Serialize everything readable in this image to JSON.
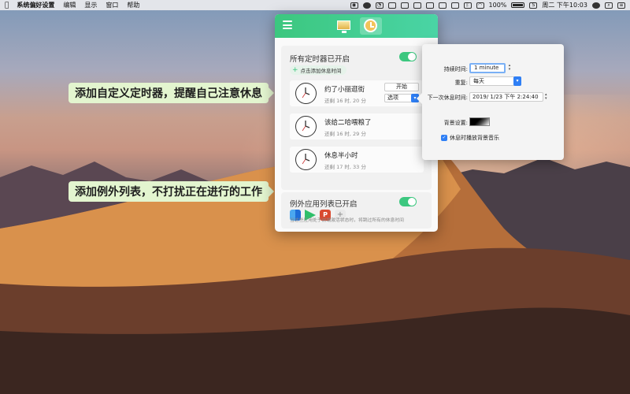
{
  "menubar": {
    "app_name": "系统偏好设置",
    "menus": [
      "编辑",
      "显示",
      "窗口",
      "帮助"
    ],
    "battery": "100%",
    "clock": "周二 下午10:03"
  },
  "callouts": {
    "timers": "添加自定义定时器，提醒自己注意休息",
    "exceptions": "添加例外列表，不打扰正在进行的工作"
  },
  "popover": {
    "tabs": [
      "screen-tab",
      "clock-tab"
    ],
    "timers_section": {
      "title": "所有定时器已开启",
      "enabled": true,
      "add_label": "点击添加休息时间",
      "timers": [
        {
          "name": "约了小丽逛街",
          "remaining": "还剩 16 时, 20 分",
          "start_label": "开始",
          "options_label": "选项"
        },
        {
          "name": "该给二哈喂粮了",
          "remaining": "还剩 16 时, 29 分"
        },
        {
          "name": "休息半小时",
          "remaining": "还剩 17 时, 33 分"
        }
      ]
    },
    "exceptions_section": {
      "title": "例外应用列表已开启",
      "enabled": true,
      "note": "当这些应用处于前端激活状态时，将跳过所有的休息时间"
    }
  },
  "detail": {
    "duration_label": "持续时间:",
    "duration_value": "1 minute",
    "repeat_label": "重复:",
    "repeat_value": "每天",
    "next_label": "下一次休息时间:",
    "next_value": "2019/ 1/23 下午 2:24:40",
    "background_label": "背景设置:",
    "music_label": "休息时播放背景音乐",
    "music_checked": true
  }
}
